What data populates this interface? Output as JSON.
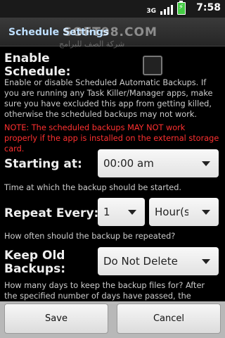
{
  "status": {
    "network": "3G",
    "time": "7:58"
  },
  "title": "Schedule Settings",
  "watermark": {
    "brand": "SOFT98.COM",
    "subtitle": "شركة الصف للبرامج"
  },
  "enable": {
    "label": "Enable Schedule:",
    "checked": false,
    "description": "Enable or disable Scheduled Automatic Backups. If you are running any Task Killer/Manager apps, make sure you have excluded this app from getting killed, otherwise the scheduled backups may not work.",
    "warning": "NOTE: The scheduled backups MAY NOT work properly if the app is installed on the external storage card."
  },
  "starting": {
    "label": "Starting at:",
    "value": "00:00 am",
    "description": "Time at which the backup should be started."
  },
  "repeat": {
    "label": "Repeat Every:",
    "count": "1",
    "unit": "Hour(s)",
    "description": "How often should the backup be repeated?"
  },
  "keep": {
    "label": "Keep Old Backups:",
    "value": "Do Not Delete",
    "description": "How many days to keep the backup files for? After the specified number of days have passed, the backup file will"
  },
  "buttons": {
    "save": "Save",
    "cancel": "Cancel"
  },
  "colors": {
    "warning": "#ff3030",
    "title": "#bfe0ff",
    "background": "#000000"
  }
}
